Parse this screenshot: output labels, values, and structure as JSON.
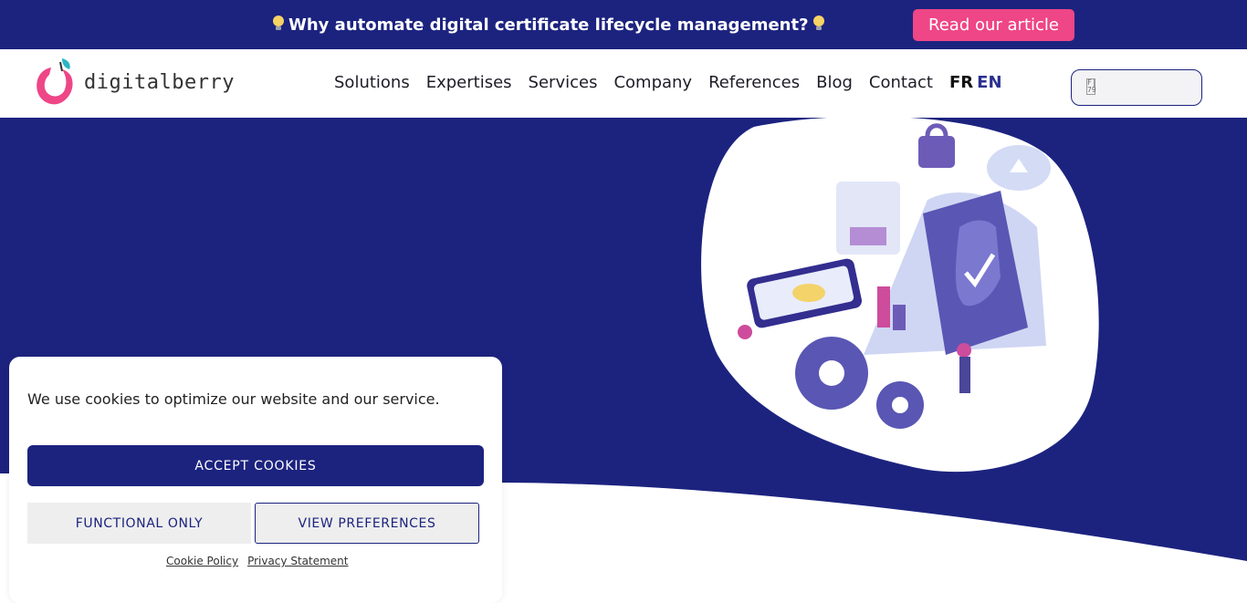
{
  "announcement": {
    "text": "Why automate digital certificate lifecycle management?",
    "button_label": "Read our article"
  },
  "header": {
    "logo_text_1": "digital",
    "logo_text_2": "berry",
    "nav": [
      {
        "label": "Solutions"
      },
      {
        "label": "Expertises"
      },
      {
        "label": "Services"
      },
      {
        "label": "Company"
      },
      {
        "label": "References"
      },
      {
        "label": "Blog"
      },
      {
        "label": "Contact"
      }
    ],
    "lang": {
      "fr": "FR",
      "en": "EN"
    },
    "search_icon_glyph": "F| 79"
  },
  "cookie_banner": {
    "message": "We use cookies to optimize our website and our service.",
    "accept_label": "ACCEPT COOKIES",
    "functional_label": "FUNCTIONAL ONLY",
    "preferences_label": "VIEW PREFERENCES",
    "links": [
      {
        "label": "Cookie Policy"
      },
      {
        "label": "Privacy Statement"
      }
    ]
  },
  "colors": {
    "navy": "#1c237f",
    "pink": "#ee4686"
  }
}
